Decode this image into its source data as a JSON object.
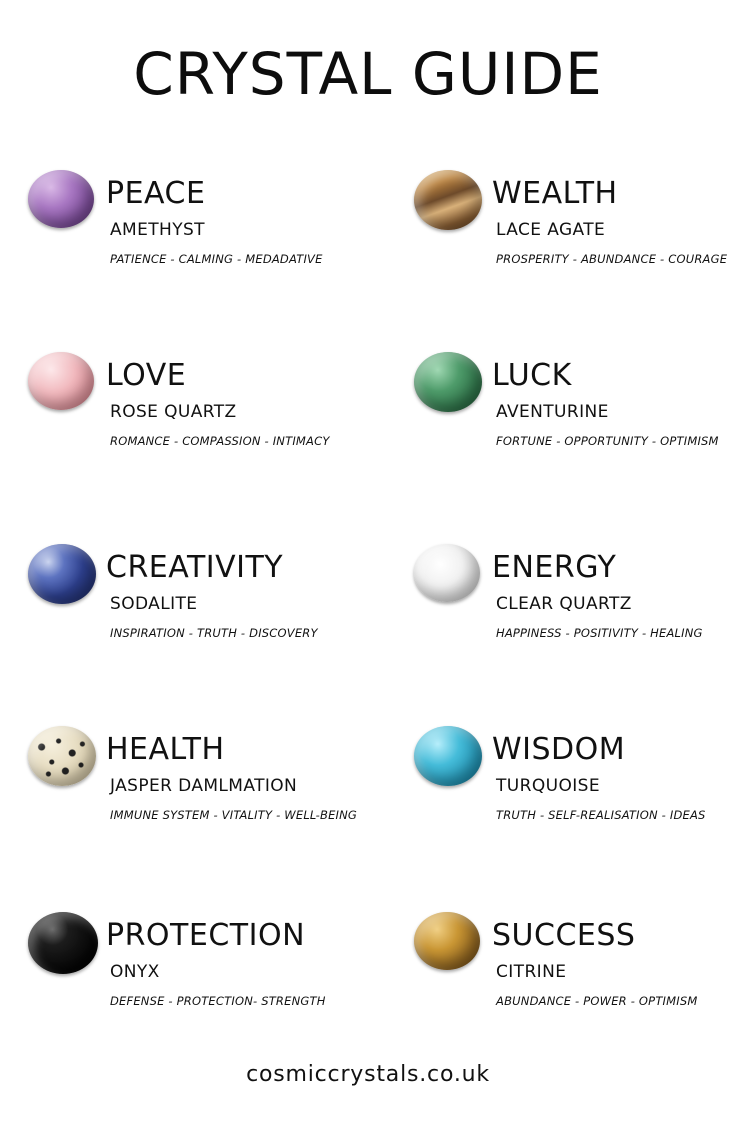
{
  "title": "CRYSTAL GUIDE",
  "footer": "cosmiccrystals.co.uk",
  "crystals": [
    {
      "heading": "PEACE",
      "stone": "AMETHYST",
      "traits": "PATIENCE  - CALMING - MEDADATIVE",
      "icon": "amethyst-stone-icon",
      "color": "#9b6bb0"
    },
    {
      "heading": "WEALTH",
      "stone": "LACE AGATE",
      "traits": "PROSPERITY - ABUNDANCE - COURAGE",
      "icon": "lace-agate-stone-icon",
      "color": "#b5874a"
    },
    {
      "heading": "LOVE",
      "stone": "ROSE QUARTZ",
      "traits": "ROMANCE - COMPASSION - INTIMACY",
      "icon": "rose-quartz-stone-icon",
      "color": "#e9a9b0"
    },
    {
      "heading": "LUCK",
      "stone": "AVENTURINE",
      "traits": "FORTUNE - OPPORTUNITY - OPTIMISM",
      "icon": "aventurine-stone-icon",
      "color": "#3f8a5b"
    },
    {
      "heading": "CREATIVITY",
      "stone": "SODALITE",
      "traits": "INSPIRATION - TRUTH - DISCOVERY",
      "icon": "sodalite-stone-icon",
      "color": "#31468f"
    },
    {
      "heading": "ENERGY",
      "stone": "CLEAR QUARTZ",
      "traits": "HAPPINESS - POSITIVITY - HEALING",
      "icon": "clear-quartz-stone-icon",
      "color": "#e4e4e4"
    },
    {
      "heading": "HEALTH",
      "stone": "JASPER DAMLMATION",
      "traits": "IMMUNE SYSTEM - VITALITY - WELL-BEING",
      "icon": "dalmatian-jasper-stone-icon",
      "color": "#e6dcc4"
    },
    {
      "heading": "WISDOM",
      "stone": "TURQUOISE",
      "traits": "TRUTH - SELF-REALISATION - IDEAS",
      "icon": "turquoise-stone-icon",
      "color": "#2fa8c6"
    },
    {
      "heading": "PROTECTION",
      "stone": "ONYX",
      "traits": "DEFENSE - PROTECTION- STRENGTH",
      "icon": "onyx-stone-icon",
      "color": "#0d0d0d"
    },
    {
      "heading": "SUCCESS",
      "stone": "CITRINE",
      "traits": "ABUNDANCE - POWER - OPTIMISM",
      "icon": "citrine-stone-icon",
      "color": "#b88a2c"
    }
  ]
}
